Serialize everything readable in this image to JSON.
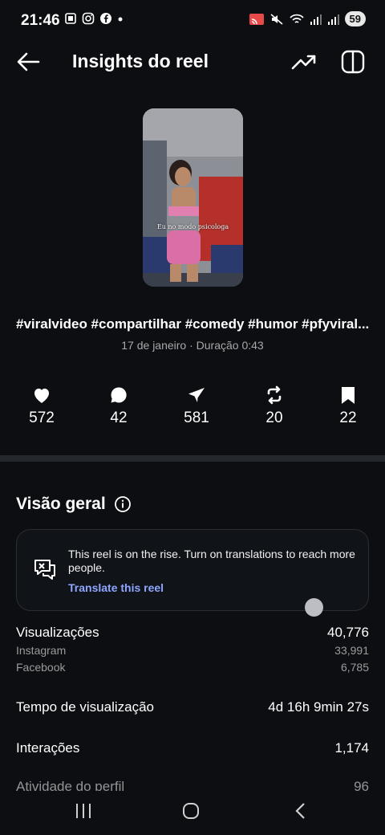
{
  "status": {
    "time": "21:46",
    "battery": "59"
  },
  "header": {
    "title": "Insights do reel"
  },
  "reel": {
    "overlay_text": "Eu no modo psicologa",
    "caption": "#viralvideo #compartilhar #comedy #humor #pfyviral...",
    "meta": "17 de janeiro · Duração 0:43"
  },
  "stats": [
    {
      "icon": "heart-icon",
      "value": "572"
    },
    {
      "icon": "comment-icon",
      "value": "42"
    },
    {
      "icon": "send-icon",
      "value": "581"
    },
    {
      "icon": "repost-icon",
      "value": "20"
    },
    {
      "icon": "bookmark-icon",
      "value": "22"
    }
  ],
  "overview": {
    "title": "Visão geral",
    "tip_text": "This reel is on the rise. Turn on translations to reach more people.",
    "tip_link": "Translate this reel"
  },
  "metrics": {
    "views_label": "Visualizações",
    "views_value": "40,776",
    "instagram_label": "Instagram",
    "instagram_value": "33,991",
    "facebook_label": "Facebook",
    "facebook_value": "6,785",
    "watch_time_label": "Tempo de visualização",
    "watch_time_value": "4d 16h 9min 27s",
    "interactions_label": "Interações",
    "interactions_value": "1,174",
    "profile_activity_label": "Atividade do perfil",
    "profile_activity_value": "96"
  },
  "colors": {
    "background": "#0c0e12",
    "accent_link": "#8ea6ff",
    "divider": "#24272c"
  }
}
